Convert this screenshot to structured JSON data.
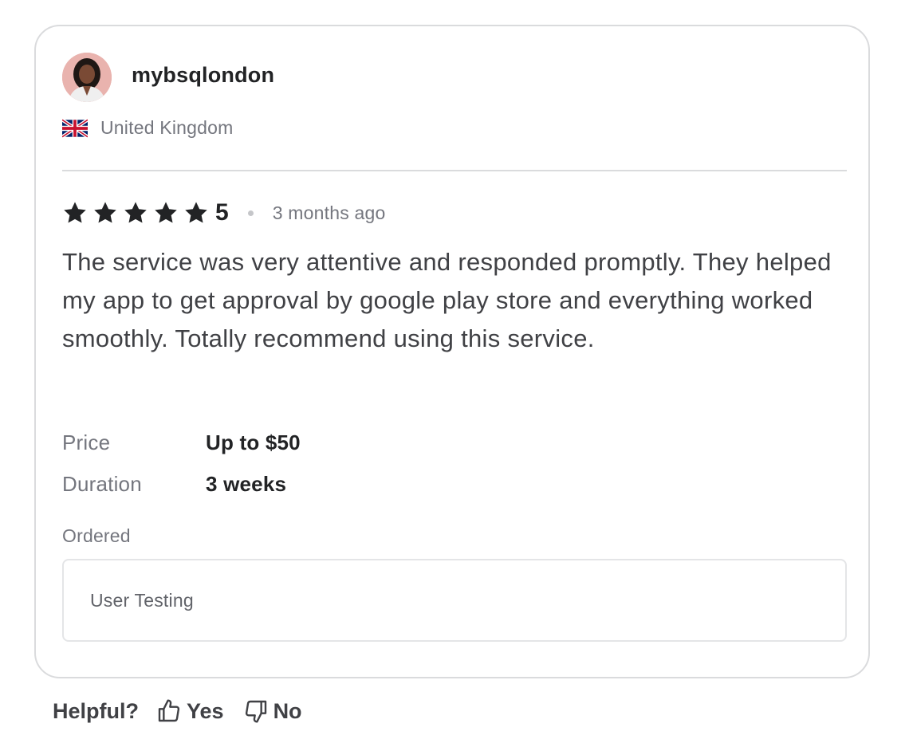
{
  "reviewer": {
    "username": "mybsqlondon",
    "country": "United Kingdom",
    "flag_icon": "uk-flag-icon",
    "avatar_icon": "avatar-photo"
  },
  "review": {
    "rating": 5,
    "rating_label": "5",
    "star_color": "#222325",
    "time_ago": "3 months ago",
    "text": "The service was very attentive and responded promptly. They helped my app to get approval by google play store and everything worked smoothly. Totally recommend using this service."
  },
  "details": {
    "price_label": "Price",
    "price_value": "Up to $50",
    "duration_label": "Duration",
    "duration_value": "3 weeks"
  },
  "ordered": {
    "label": "Ordered",
    "value": "User Testing"
  },
  "helpful": {
    "label": "Helpful?",
    "yes_label": "Yes",
    "yes_icon": "thumbs-up-icon",
    "no_label": "No",
    "no_icon": "thumbs-down-icon"
  }
}
